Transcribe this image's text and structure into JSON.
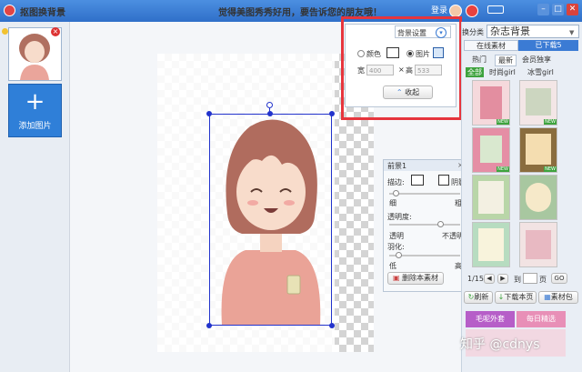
{
  "window": {
    "title": "抠图换背景",
    "promo": "觉得美图秀秀好用，要告诉您的朋友哦！",
    "login_label": "登录"
  },
  "left_panel": {
    "add_label": "添加图片"
  },
  "bg_settings": {
    "title": "背景设置",
    "color_option": "颜色",
    "image_option": "图片",
    "width_label": "宽",
    "width_value": "400",
    "times": "×",
    "height_label": "高",
    "height_value": "533",
    "collapse_label": "收起"
  },
  "foreground": {
    "title": "前景1",
    "stroke_label": "描边:",
    "shadow_label": "阴影",
    "thin_label": "细",
    "thick_label": "粗",
    "opacity_label": "透明度:",
    "opacity_min": "透明",
    "opacity_max": "不透明",
    "feather_label": "羽化:",
    "feather_low": "低",
    "feather_high": "高",
    "delete_label": "删除本素材",
    "opacity": 0.75,
    "feather": 0.1,
    "stroke_width": 0.05
  },
  "right_panel": {
    "category_label": "换分类",
    "category_value": "杂志背景",
    "tabs": [
      "在线素材",
      "已下载5"
    ],
    "sort": [
      "热门",
      "最新",
      "会员独享"
    ],
    "filters": [
      "全部",
      "时尚girl",
      "冰雪girl"
    ],
    "new_badge": "NEW",
    "pagination": {
      "page": "1/15",
      "goto_label": "到",
      "page_suffix": "页",
      "go_label": "GO"
    },
    "actions": [
      "刷新",
      "下载本页",
      "素材包"
    ],
    "banners": [
      "毛呢外套",
      "每日精选"
    ]
  },
  "watermark": "知乎 @cdnys",
  "colors": {
    "titlebar": "#3b7bd4",
    "highlight_red": "#e6353d",
    "selection_blue": "#2233cc",
    "add_button": "#2f7fd8"
  }
}
